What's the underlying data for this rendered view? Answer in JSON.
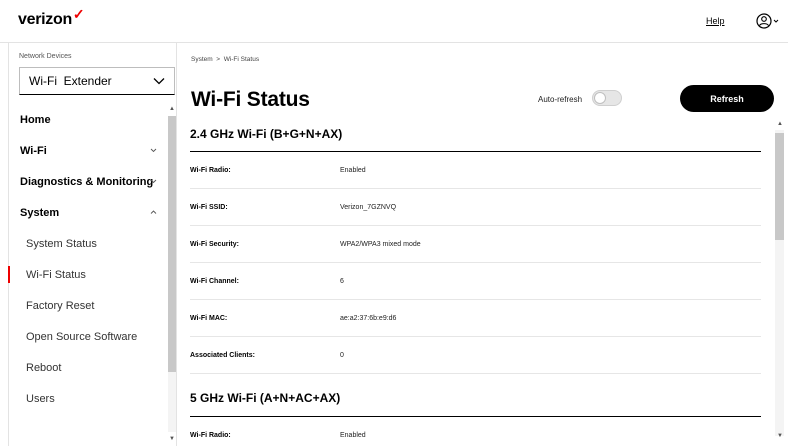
{
  "header": {
    "logo_text": "verizon",
    "logo_mark": "✓",
    "help_label": "Help",
    "account_icon": "account-circle-icon"
  },
  "sidebar": {
    "network_devices_label": "Network Devices",
    "network_devices_selected": "Wi-Fi  Extender",
    "items": [
      {
        "label": "Home",
        "level": "top",
        "caret": ""
      },
      {
        "label": "Wi-Fi",
        "level": "top",
        "caret": "down"
      },
      {
        "label": "Diagnostics & Monitoring",
        "level": "top",
        "caret": "down"
      },
      {
        "label": "System",
        "level": "top",
        "caret": "up"
      },
      {
        "label": "System Status",
        "level": "sub",
        "caret": ""
      },
      {
        "label": "Wi-Fi Status",
        "level": "sub",
        "caret": "",
        "active": true
      },
      {
        "label": "Factory Reset",
        "level": "sub",
        "caret": ""
      },
      {
        "label": "Open Source Software",
        "level": "sub",
        "caret": ""
      },
      {
        "label": "Reboot",
        "level": "sub",
        "caret": ""
      },
      {
        "label": "Users",
        "level": "sub",
        "caret": ""
      }
    ]
  },
  "main": {
    "breadcrumb": "System  >  Wi-Fi Status",
    "title": "Wi-Fi Status",
    "auto_refresh_label": "Auto-refresh",
    "auto_refresh_on": false,
    "refresh_label": "Refresh",
    "sections": [
      {
        "title": "2.4 GHz Wi-Fi (B+G+N+AX)",
        "rows": [
          {
            "label": "Wi-Fi Radio:",
            "value": "Enabled"
          },
          {
            "label": "Wi-Fi SSID:",
            "value": "Verizon_7GZNVQ"
          },
          {
            "label": "Wi-Fi Security:",
            "value": "WPA2/WPA3 mixed mode"
          },
          {
            "label": "Wi-Fi Channel:",
            "value": "6"
          },
          {
            "label": "Wi-Fi MAC:",
            "value": "ae:a2:37:6b:e9:d6"
          },
          {
            "label": "Associated Clients:",
            "value": "0"
          }
        ]
      },
      {
        "title": "5 GHz Wi-Fi (A+N+AC+AX)",
        "rows": [
          {
            "label": "Wi-Fi Radio:",
            "value": "Enabled"
          }
        ]
      }
    ]
  },
  "colors": {
    "brand_red": "#ee0000",
    "button_black": "#000000",
    "divider": "#e6e6e6"
  }
}
